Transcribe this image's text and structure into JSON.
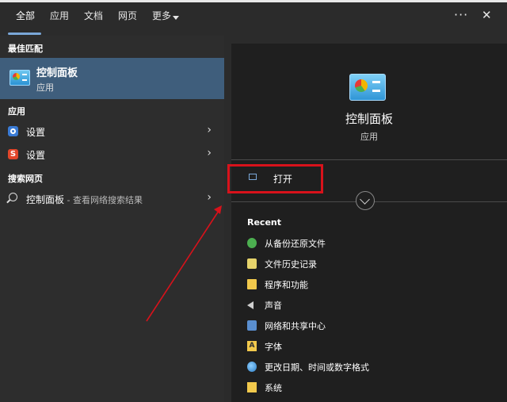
{
  "tabs": [
    {
      "label": "全部"
    },
    {
      "label": "应用"
    },
    {
      "label": "文档"
    },
    {
      "label": "网页"
    },
    {
      "label": "更多"
    }
  ],
  "window_controls": {
    "more_label": "···",
    "close_label": "✕"
  },
  "left": {
    "best_match_heading": "最佳匹配",
    "best_match": {
      "name": "控制面板",
      "type": "应用"
    },
    "apps_heading": "应用",
    "apps": [
      {
        "label": "设置",
        "icon": "gear-icon"
      },
      {
        "label": "设置",
        "icon": "weibo-icon"
      }
    ],
    "web_heading": "搜索网页",
    "web_result": {
      "label": "控制面板",
      "sub": " - 查看网络搜索结果"
    }
  },
  "detail": {
    "title": "控制面板",
    "type": "应用",
    "open_label": "打开",
    "recent_heading": "Recent",
    "recent": [
      {
        "label": "从备份还原文件",
        "icon": "recycle-icon"
      },
      {
        "label": "文件历史记录",
        "icon": "history-icon"
      },
      {
        "label": "程序和功能",
        "icon": "folder-icon"
      },
      {
        "label": "声音",
        "icon": "speaker-icon"
      },
      {
        "label": "网络和共享中心",
        "icon": "network-icon"
      },
      {
        "label": "字体",
        "icon": "font-icon"
      },
      {
        "label": "更改日期、时间或数字格式",
        "icon": "globe-icon"
      },
      {
        "label": "系统",
        "icon": "system-icon"
      }
    ]
  },
  "colors": {
    "accent": "#3f5e7c",
    "highlight_box": "#d8121b",
    "arrow": "#d8121b"
  }
}
